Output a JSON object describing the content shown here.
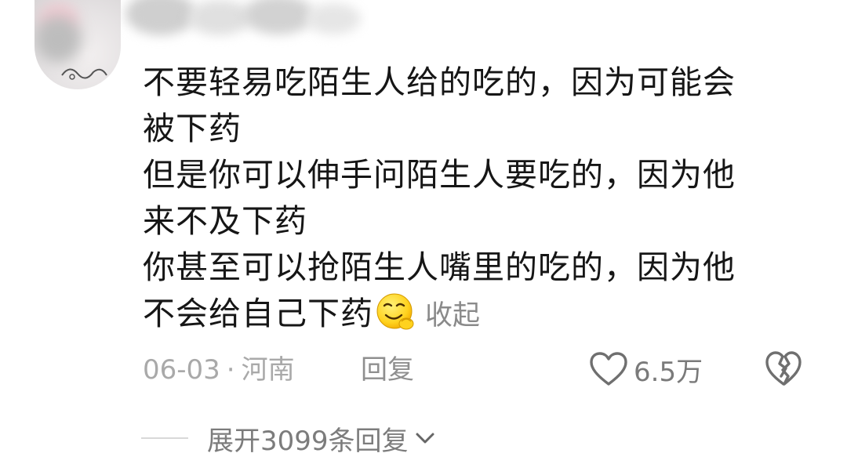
{
  "comment": {
    "lines": [
      "不要轻易吃陌生人给的吃的，因为可能会",
      "被下药",
      "但是你可以伸手问陌生人要吃的，因为他",
      "来不及下药",
      "你甚至可以抢陌生人嘴里的吃的，因为他",
      "不会给自己下药"
    ],
    "emoji": "smirk-emoji",
    "collapse_label": "收起"
  },
  "meta": {
    "date": "06-03",
    "separator": "·",
    "location": "河南",
    "reply_label": "回复"
  },
  "like": {
    "count": "6.5万",
    "icon": "heart-outline-icon"
  },
  "dislike": {
    "icon": "broken-heart-icon"
  },
  "replies": {
    "expand_label": "展开3099条回复",
    "icon": "chevron-down-icon"
  },
  "colors": {
    "text": "#161616",
    "muted": "#a9a9a9",
    "icon": "#7a7a7a"
  }
}
